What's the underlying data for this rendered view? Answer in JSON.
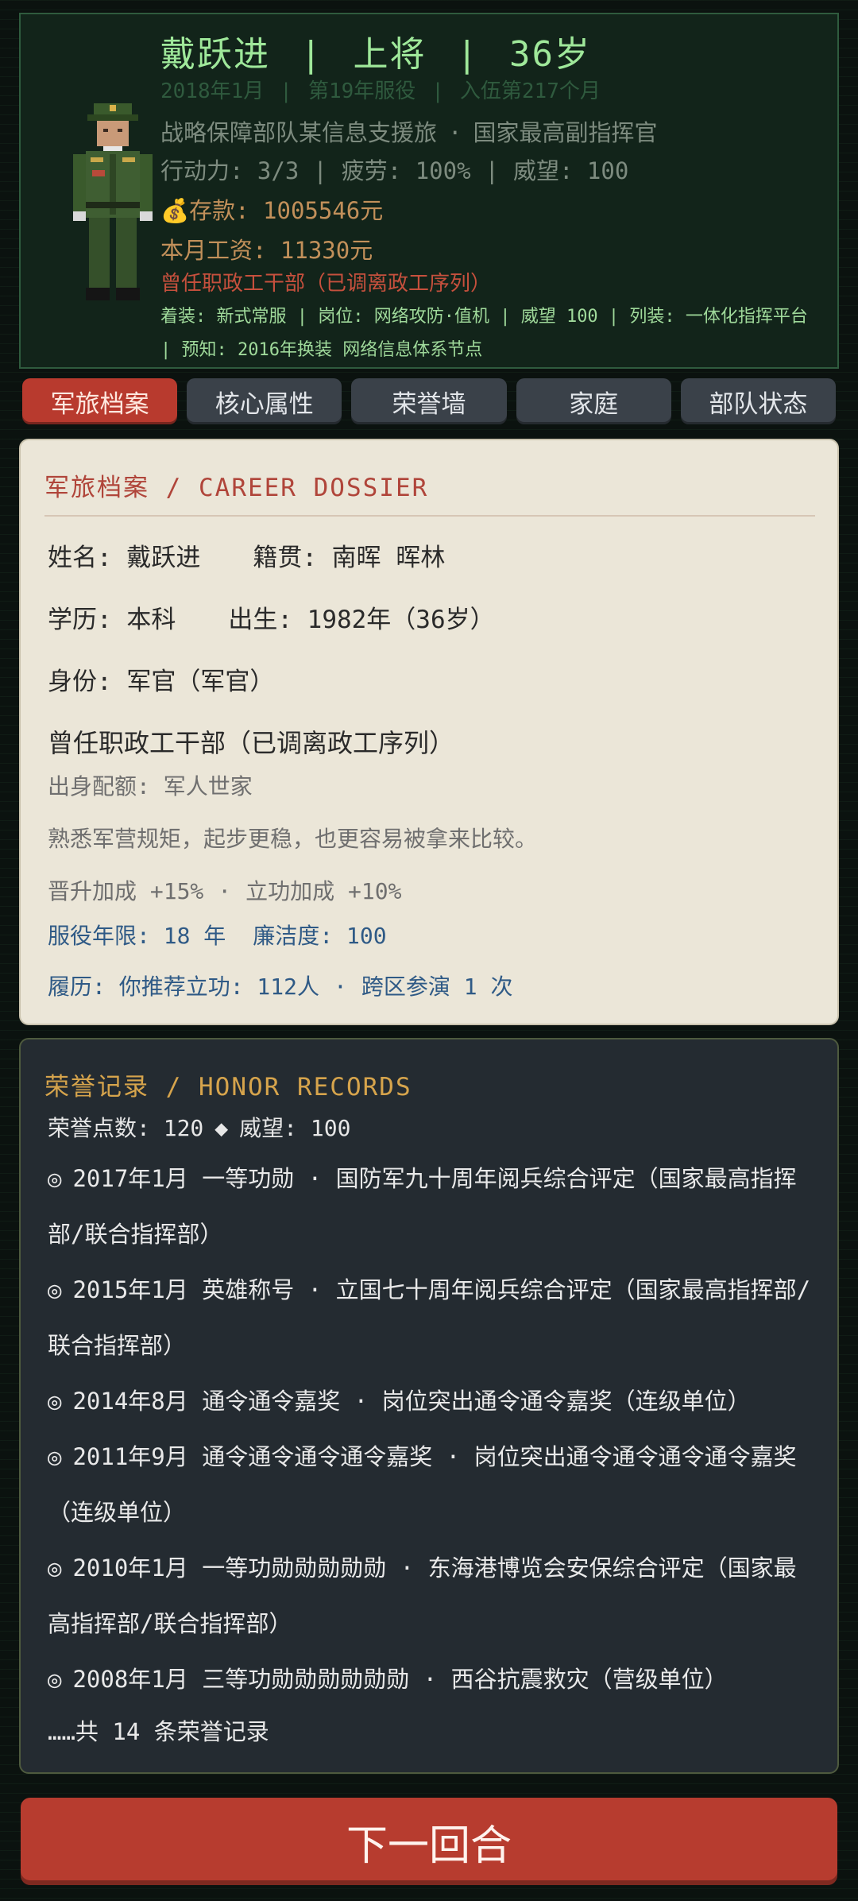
{
  "header": {
    "name": "戴跃进",
    "rank": "上将",
    "age": "36岁",
    "sep": "|",
    "date": "2018年1月",
    "service_year": "第19年服役",
    "months": "入伍第217个月",
    "unit": "战略保障部队某信息支援旅",
    "dot": "·",
    "post": "国家最高副指挥官",
    "action": "行动力: 3/3",
    "fatigue": "疲劳: 100%",
    "prestige": "威望: 100",
    "money_icon": "💰",
    "savings": "存款: 1005546元",
    "salary": "本月工资: 11330元",
    "former": "曾任职政工干部（已调离政工序列）",
    "equip": "着装: 新式常服 | 岗位: 网络攻防·值机 | 威望 100 | 列装: 一体化指挥平台 | 预知: 2016年换装 网络信息体系节点"
  },
  "tabs": [
    {
      "label": "军旅档案",
      "active": true
    },
    {
      "label": "核心属性",
      "active": false
    },
    {
      "label": "荣誉墙",
      "active": false
    },
    {
      "label": "家庭",
      "active": false
    },
    {
      "label": "部队状态",
      "active": false
    }
  ],
  "dossier": {
    "heading": "军旅档案 / CAREER DOSSIER",
    "name": "姓名: 戴跃进",
    "origin": "籍贯: 南晖 晖林",
    "education": "学历: 本科",
    "birth": "出生: 1982年（36岁）",
    "identity": "身份: 军官（军官）",
    "former": "曾任职政工干部（已调离政工序列）",
    "background": "出身配额: 军人世家",
    "desc": "熟悉军营规矩，起步更稳，也更容易被拿来比较。",
    "bonus_promo": "晋升加成 +15%",
    "dot": "·",
    "bonus_merit": "立功加成 +10%",
    "service_years": "服役年限: 18 年",
    "integrity": "廉洁度: 100",
    "resume": "履历: 你推荐立功: 112人",
    "exercise": "跨区参演 1 次"
  },
  "honor": {
    "heading": "荣誉记录 / HONOR RECORDS",
    "points": "荣誉点数: 120",
    "diamond": "◆",
    "prestige": "威望: 100",
    "bullet": "◎",
    "items": [
      "2017年1月 一等功勋 · 国防军九十周年阅兵综合评定（国家最高指挥部/联合指挥部）",
      "2015年1月 英雄称号 · 立国七十周年阅兵综合评定（国家最高指挥部/联合指挥部）",
      "2014年8月 通令通令嘉奖 · 岗位突出通令通令嘉奖（连级单位）",
      "2011年9月 通令通令通令通令嘉奖 · 岗位突出通令通令通令通令嘉奖（连级单位）",
      "2010年1月 一等功勋勋勋勋勋 · 东海港博览会安保综合评定（国家最高指挥部/联合指挥部）",
      "2008年1月 三等功勋勋勋勋勋勋 · 西谷抗震救灾（营级单位）"
    ],
    "more": "……共 14 条荣誉记录"
  },
  "next_button": "下一回合",
  "colors": {
    "accent_red": "#b83a2e",
    "header_green": "#9fe89a",
    "honor_gold": "#d6a44c"
  }
}
